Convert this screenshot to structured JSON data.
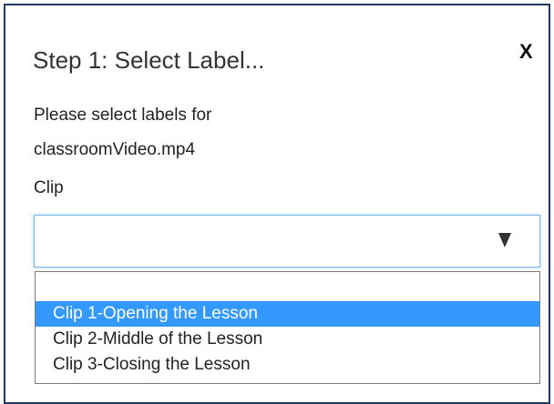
{
  "dialog": {
    "title": "Step 1: Select Label...",
    "close_label": "X",
    "instructions": "Please select labels for classroomVideo.mp4"
  },
  "clip_field": {
    "label": "Clip",
    "selected_value": "",
    "dropdown_icon": "triangle-down-icon",
    "options": [
      {
        "label": "",
        "selected": false
      },
      {
        "label": "Clip 1-Opening the Lesson",
        "selected": true
      },
      {
        "label": "Clip 2-Middle of the Lesson",
        "selected": false
      },
      {
        "label": "Clip 3-Closing the Lesson",
        "selected": false
      }
    ]
  },
  "colors": {
    "dialog_border": "#1f3864",
    "selected_option_bg": "#3399ff",
    "select_focus_border": "#7eb4ea"
  }
}
